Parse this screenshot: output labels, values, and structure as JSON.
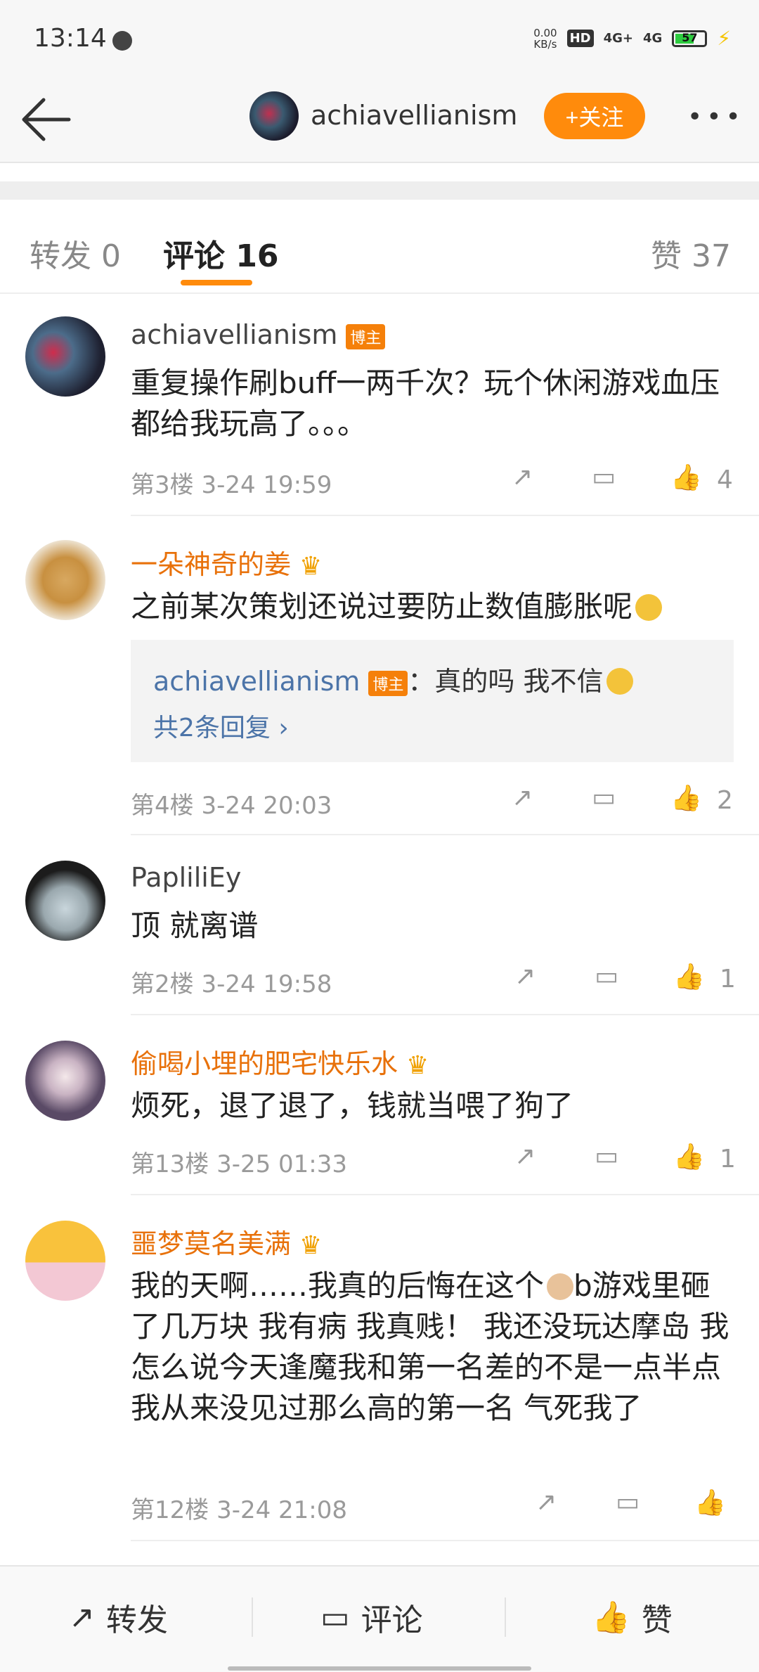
{
  "status_bar": {
    "time": "13:14",
    "net_speed_value": "0.00",
    "net_speed_unit": "KB/s",
    "hd_label": "HD",
    "signal_1": "4G+",
    "signal_2": "4G",
    "battery": "57"
  },
  "header": {
    "username": "achiavellianism",
    "follow_label": "+关注",
    "more_label": "•••"
  },
  "tabs": {
    "repost": "转发 0",
    "comments": "评论 16",
    "likes": "赞 37"
  },
  "comments": [
    {
      "user": "achiavellianism",
      "badge": "博主",
      "text": "重复操作刷buff一两千次？玩个休闲游戏血压都给我玩高了。。。",
      "meta": "第3楼 3-24 19:59",
      "likes": "4"
    },
    {
      "user": "一朵神奇的姜",
      "text": "之前某次策划还说过要防止数值膨胀呢",
      "reply": {
        "user": "achiavellianism",
        "badge": "博主",
        "text": "：真的吗 我不信",
        "more": "共2条回复 ›"
      },
      "meta": "第4楼 3-24 20:03",
      "likes": "2"
    },
    {
      "user": "PapliliEy",
      "text": "顶 就离谱",
      "meta": "第2楼 3-24 19:58",
      "likes": "1"
    },
    {
      "user": "偷喝小埋的肥宅快乐水",
      "text": "烦死，退了退了，钱就当喂了狗了",
      "meta": "第13楼 3-25 01:33",
      "likes": "1"
    },
    {
      "user": "噩梦莫名美满",
      "text_line1a": "我的天啊……我真的后悔在这个",
      "text_line1b": "b游戏里",
      "text_rest": "砸了几万块 我有病 我真贱！ 我还没玩达摩岛 我怎么说今天逢魔我和第一名差的不是一点半点 我从来没见过那么高的第一名 气死我了",
      "meta": "第12楼 3-24 21:08",
      "likes": ""
    }
  ],
  "bottom_bar": {
    "repost": "转发",
    "comment": "评论",
    "like": "赞"
  },
  "colors": {
    "accent": "#ff8b0c",
    "vip_name": "#e8710a",
    "link": "#4c74a8"
  }
}
